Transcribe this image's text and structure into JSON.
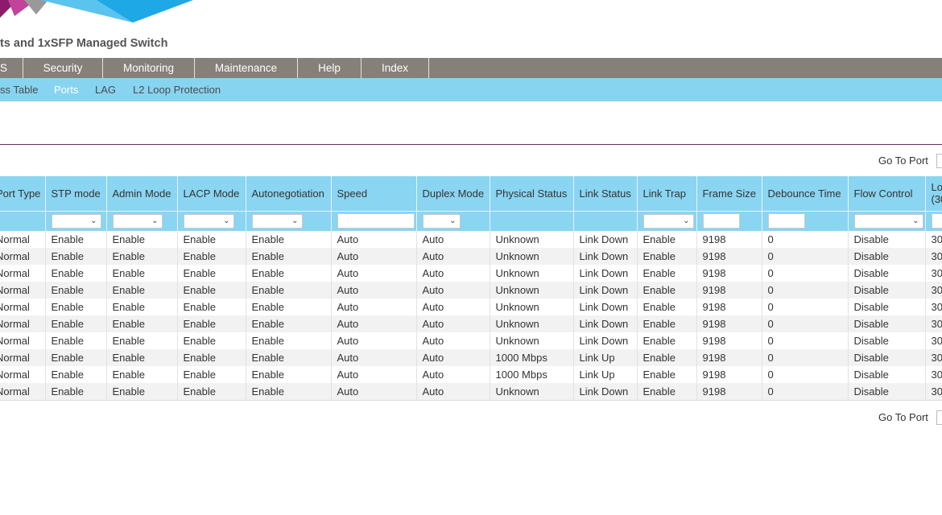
{
  "header": {
    "product_title": "ts and 1xSFP Managed Switch",
    "logo_colors": [
      "#8c1b6e",
      "#c2439a",
      "#999999",
      "#5bc4ee",
      "#1fa8e6"
    ]
  },
  "menu": {
    "items": [
      {
        "label": "S"
      },
      {
        "label": "Security"
      },
      {
        "label": "Monitoring"
      },
      {
        "label": "Maintenance"
      },
      {
        "label": "Help"
      },
      {
        "label": "Index"
      }
    ]
  },
  "subnav": {
    "items": [
      {
        "label": "ss Table",
        "active": false
      },
      {
        "label": "Ports",
        "active": true
      },
      {
        "label": "LAG",
        "active": false
      },
      {
        "label": "L2 Loop Protection",
        "active": false
      }
    ]
  },
  "goto": {
    "label": "Go To Port"
  },
  "table": {
    "headers": [
      "Port Type",
      "STP mode",
      "Admin Mode",
      "LACP Mode",
      "Autonegotiation",
      "Speed",
      "Duplex Mode",
      "Physical Status",
      "Link Status",
      "Link Trap",
      "Frame Size",
      "Debounce Time",
      "Flow Control",
      "Lo (30"
    ],
    "filters": [
      "none",
      "select",
      "select",
      "select",
      "select",
      "text",
      "select",
      "none",
      "none",
      "select",
      "text",
      "text",
      "select",
      "text"
    ],
    "rows": [
      [
        "Normal",
        "Enable",
        "Enable",
        "Enable",
        "Enable",
        "Auto",
        "Auto",
        "Unknown",
        "Link Down",
        "Enable",
        "9198",
        "0",
        "Disable",
        "30"
      ],
      [
        "Normal",
        "Enable",
        "Enable",
        "Enable",
        "Enable",
        "Auto",
        "Auto",
        "Unknown",
        "Link Down",
        "Enable",
        "9198",
        "0",
        "Disable",
        "30"
      ],
      [
        "Normal",
        "Enable",
        "Enable",
        "Enable",
        "Enable",
        "Auto",
        "Auto",
        "Unknown",
        "Link Down",
        "Enable",
        "9198",
        "0",
        "Disable",
        "30"
      ],
      [
        "Normal",
        "Enable",
        "Enable",
        "Enable",
        "Enable",
        "Auto",
        "Auto",
        "Unknown",
        "Link Down",
        "Enable",
        "9198",
        "0",
        "Disable",
        "30"
      ],
      [
        "Normal",
        "Enable",
        "Enable",
        "Enable",
        "Enable",
        "Auto",
        "Auto",
        "Unknown",
        "Link Down",
        "Enable",
        "9198",
        "0",
        "Disable",
        "30"
      ],
      [
        "Normal",
        "Enable",
        "Enable",
        "Enable",
        "Enable",
        "Auto",
        "Auto",
        "Unknown",
        "Link Down",
        "Enable",
        "9198",
        "0",
        "Disable",
        "30"
      ],
      [
        "Normal",
        "Enable",
        "Enable",
        "Enable",
        "Enable",
        "Auto",
        "Auto",
        "Unknown",
        "Link Down",
        "Enable",
        "9198",
        "0",
        "Disable",
        "30"
      ],
      [
        "Normal",
        "Enable",
        "Enable",
        "Enable",
        "Enable",
        "Auto",
        "Auto",
        "1000 Mbps",
        "Link Up",
        "Enable",
        "9198",
        "0",
        "Disable",
        "30"
      ],
      [
        "Normal",
        "Enable",
        "Enable",
        "Enable",
        "Enable",
        "Auto",
        "Auto",
        "1000 Mbps",
        "Link Up",
        "Enable",
        "9198",
        "0",
        "Disable",
        "30"
      ],
      [
        "Normal",
        "Enable",
        "Enable",
        "Enable",
        "Enable",
        "Auto",
        "Auto",
        "Unknown",
        "Link Down",
        "Enable",
        "9198",
        "0",
        "Disable",
        "30"
      ]
    ]
  }
}
